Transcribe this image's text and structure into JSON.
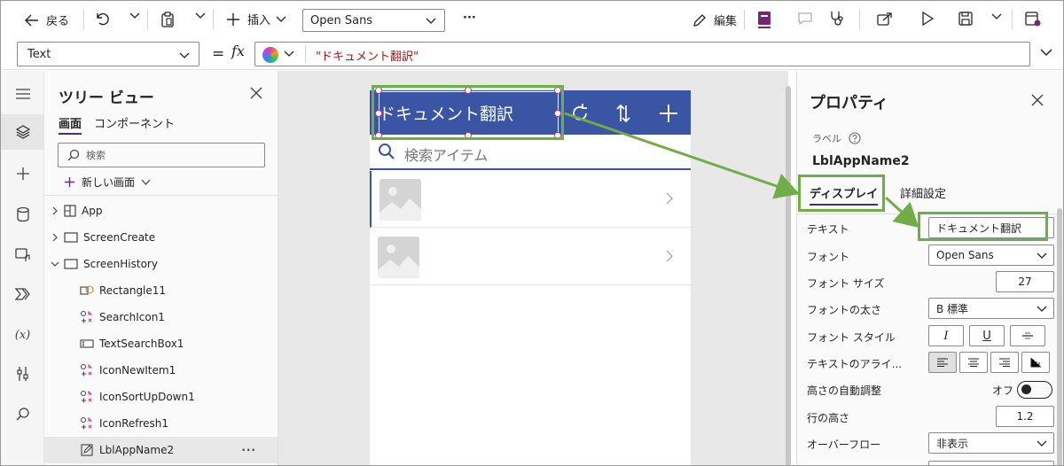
{
  "toolbar": {
    "back_label": "戻る",
    "insert_label": "插入",
    "font_value": "Open Sans",
    "more_label": "···",
    "edit_label": "編集"
  },
  "formula": {
    "property_value": "Text",
    "eq": "=",
    "fx": "fx",
    "text": "\"ドキュメント翻訳\""
  },
  "tree": {
    "title": "ツリー ビュー",
    "tab_screens": "画面",
    "tab_components": "コンポーネント",
    "search_placeholder": "検索",
    "new_screen": "新しい画面",
    "items": [
      {
        "label": "App",
        "icon": "app-icon"
      },
      {
        "label": "ScreenCreate",
        "icon": "screen-icon"
      },
      {
        "label": "ScreenHistory",
        "icon": "screen-icon"
      },
      {
        "label": "Rectangle11",
        "icon": "shapes-icon"
      },
      {
        "label": "SearchIcon1",
        "icon": "icon-control-icon"
      },
      {
        "label": "TextSearchBox1",
        "icon": "textinput-icon"
      },
      {
        "label": "IconNewItem1",
        "icon": "icon-control-icon"
      },
      {
        "label": "IconSortUpDown1",
        "icon": "icon-control-icon"
      },
      {
        "label": "IconRefresh1",
        "icon": "icon-control-icon"
      },
      {
        "label": "LblAppName2",
        "icon": "label-edit-icon"
      }
    ],
    "more": "···"
  },
  "canvas": {
    "app_title": "ドキュメント翻訳",
    "search_placeholder": "検索アイテム"
  },
  "props": {
    "title": "プロパティ",
    "type_label": "ラベル",
    "control_name": "LblAppName2",
    "tab_display": "ディスプレイ",
    "tab_advanced": "詳細設定",
    "rows": {
      "text_label": "テキスト",
      "text_value": "ドキュメント翻訳",
      "font_label": "フォント",
      "font_value": "Open Sans",
      "size_label": "フォント サイズ",
      "size_value": "27",
      "weight_label": "フォントの太さ",
      "weight_value": "B  標準",
      "style_label": "フォント スタイル",
      "align_label": "テキストのアライ...",
      "autoheight_label": "高さの自動調整",
      "autoheight_value": "オフ",
      "lineheight_label": "行の高さ",
      "lineheight_value": "1.2",
      "overflow_label": "オーバーフロー",
      "overflow_value": "非表示"
    }
  },
  "colors": {
    "accent": "#4b2d73",
    "app_header": "#3955a3",
    "annotation": "#70ad47",
    "formula_string": "#a31515"
  }
}
